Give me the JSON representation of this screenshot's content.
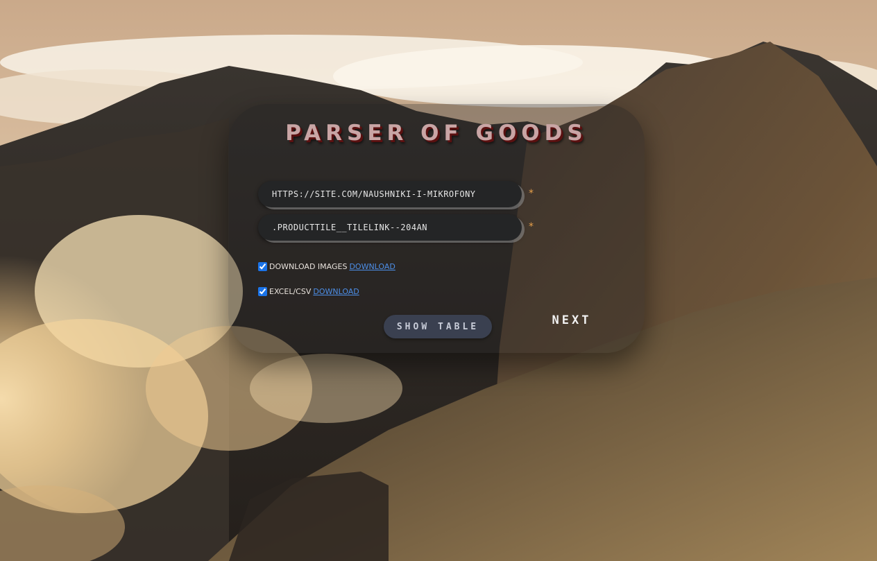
{
  "app": {
    "title": "PARSER OF GOODS"
  },
  "form": {
    "url_input": {
      "value": "HTTPS://SITE.COM/NAUSHNIKI-I-MIKROFONY",
      "required_mark": "*"
    },
    "selector_input": {
      "value": ".PRODUCTTILE__TILELINK--204AN",
      "required_mark": "*"
    },
    "options": [
      {
        "label": "DOWNLOAD IMAGES",
        "link": "DOWNLOAD",
        "checked": true
      },
      {
        "label": "EXCEL/CSV",
        "link": "DOWNLOAD",
        "checked": true
      }
    ]
  },
  "buttons": {
    "show_table": "SHOW TABLE",
    "next": "NEXT"
  },
  "colors": {
    "title": "#c9a5a5",
    "title_shadow": "#5a1010",
    "required": "#e6a04a",
    "link": "#4d8fe8",
    "show_button_bg": "#3a4050",
    "card_bg": "rgba(30,30,32,0.34)"
  },
  "background": {
    "icon": "mountain-clouds-landscape"
  }
}
